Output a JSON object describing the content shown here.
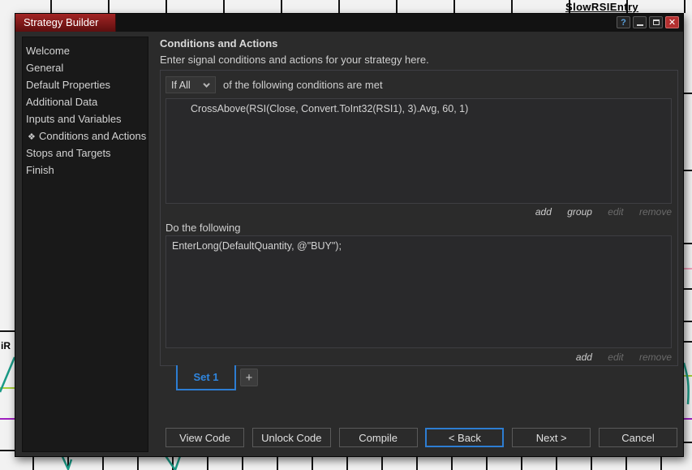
{
  "background": {
    "chart_label_top": "SlowRSIEntry",
    "chart_label_left": "iR"
  },
  "window": {
    "title": "Strategy Builder",
    "help_glyph": "?",
    "close_glyph": "✕"
  },
  "sidebar": {
    "items": [
      {
        "label": "Welcome"
      },
      {
        "label": "General"
      },
      {
        "label": "Default Properties"
      },
      {
        "label": "Additional Data"
      },
      {
        "label": "Inputs and Variables"
      },
      {
        "label": "Conditions and Actions",
        "selected": true,
        "icon": "❖"
      },
      {
        "label": "Stops and Targets"
      },
      {
        "label": "Finish"
      }
    ]
  },
  "main": {
    "heading": "Conditions and Actions",
    "subheading": "Enter signal conditions and actions for your strategy here.",
    "conditions": {
      "match_value": "If All",
      "suffix": "of the following conditions are met",
      "expression": "CrossAbove(RSI(Close, Convert.ToInt32(RSI1), 3).Avg, 60, 1)",
      "links": {
        "add": "add",
        "group": "group",
        "edit": "edit",
        "remove": "remove"
      }
    },
    "actions": {
      "label": "Do the following",
      "expression": "EnterLong(DefaultQuantity, @\"BUY\");",
      "links": {
        "add": "add",
        "edit": "edit",
        "remove": "remove"
      }
    },
    "sets": {
      "active_tab": "Set 1",
      "add_label": "+"
    },
    "footer_buttons": [
      "View Code",
      "Unlock Code",
      "Compile",
      "< Back",
      "Next >",
      "Cancel"
    ]
  },
  "colors": {
    "accent_blue": "#2d7dd2",
    "title_red": "#8f1d1d",
    "dialog_bg": "#2b2b2b",
    "sidebar_bg": "#191919",
    "teal_plot": "#1a9a86",
    "purple_line": "#a020c0",
    "yellowgreen_line": "#a6ce39",
    "pink_line": "#f2a0bb"
  }
}
